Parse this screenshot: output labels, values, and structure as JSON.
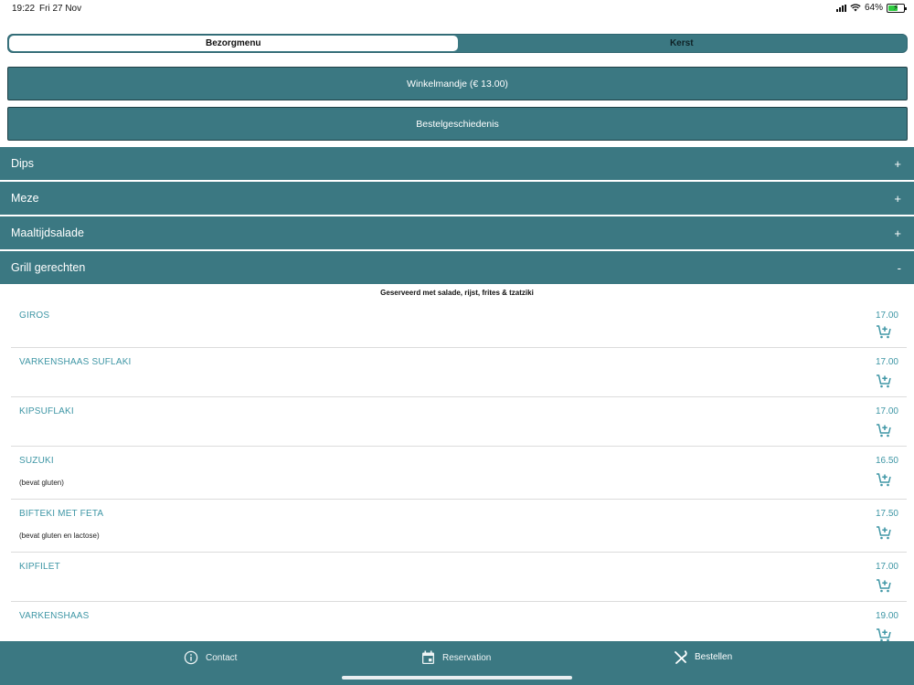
{
  "status_bar": {
    "time": "19:22",
    "date": "Fri 27 Nov",
    "battery_percent": "64%",
    "battery_level": 0.64,
    "battery_color": "#2ecc40"
  },
  "segmented": {
    "tabs": [
      {
        "label": "Bezorgmenu",
        "active": true
      },
      {
        "label": "Kerst",
        "active": false
      }
    ]
  },
  "cart_button": {
    "label": "Winkelmandje (€ 13.00)"
  },
  "history_button": {
    "label": "Bestelgeschiedenis"
  },
  "categories": [
    {
      "label": "Dips",
      "sign": "+"
    },
    {
      "label": "Meze",
      "sign": "+"
    },
    {
      "label": "Maaltijdsalade",
      "sign": "+"
    },
    {
      "label": "Grill gerechten",
      "sign": "-"
    }
  ],
  "grill": {
    "subtitle": "Geserveerd met salade, rijst, frites & tzatziki",
    "items": [
      {
        "name": "GIROS",
        "price": "17.00",
        "note": ""
      },
      {
        "name": "VARKENSHAAS SUFLAKI",
        "price": "17.00",
        "note": ""
      },
      {
        "name": "KIPSUFLAKI",
        "price": "17.00",
        "note": ""
      },
      {
        "name": "SUZUKI",
        "price": "16.50",
        "note": "(bevat gluten)"
      },
      {
        "name": "BIFTEKI MET FETA",
        "price": "17.50",
        "note": "(bevat gluten en lactose)"
      },
      {
        "name": "KIPFILET",
        "price": "17.00",
        "note": ""
      },
      {
        "name": "VARKENSHAAS",
        "price": "19.00",
        "note": ""
      }
    ]
  },
  "tabbar": {
    "contact": "Contact",
    "reservation": "Reservation",
    "order": "Bestellen"
  },
  "colors": {
    "accent": "#3b7882",
    "item_text": "#3e96a5"
  }
}
